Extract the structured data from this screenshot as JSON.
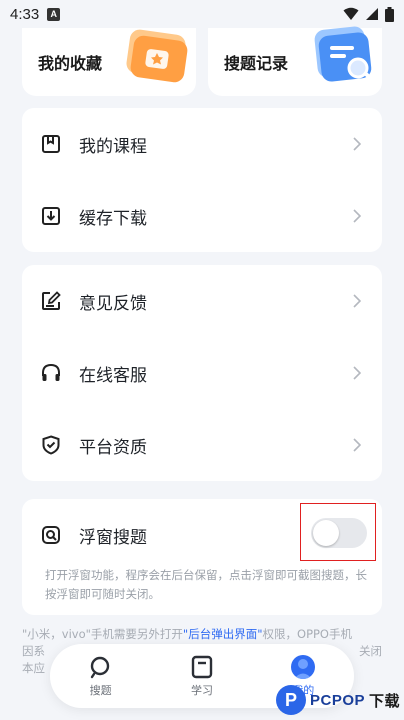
{
  "status": {
    "time": "4:33",
    "app_badge": "A"
  },
  "quick": [
    {
      "label": "我的收藏",
      "icon": "folder-star-icon"
    },
    {
      "label": "搜题记录",
      "icon": "search-doc-icon"
    }
  ],
  "group1": [
    {
      "label": "我的课程",
      "icon": "bookmark-icon"
    },
    {
      "label": "缓存下载",
      "icon": "download-icon"
    }
  ],
  "group2": [
    {
      "label": "意见反馈",
      "icon": "edit-icon"
    },
    {
      "label": "在线客服",
      "icon": "headset-icon"
    },
    {
      "label": "平台资质",
      "icon": "shield-check-icon"
    }
  ],
  "floating": {
    "label": "浮窗搜题",
    "icon": "float-search-icon",
    "toggle_state": "off",
    "desc": "打开浮窗功能，程序会在后台保留，点击浮窗即可截图搜题，长按浮窗即可随时关闭。"
  },
  "notice": {
    "line1_a": "\"小米，vivo\"手机需要另外打开",
    "line1_hl": "\"后台弹出界面\"",
    "line1_b": "权限，OPPO手机",
    "line2": "因系",
    "line2_end": "关闭",
    "line3": "本应"
  },
  "tabs": [
    {
      "label": "搜题",
      "icon": "search-tab-icon",
      "active": false
    },
    {
      "label": "学习",
      "icon": "book-tab-icon",
      "active": false
    },
    {
      "label": "我的",
      "icon": "profile-tab-icon",
      "active": true
    }
  ],
  "watermark": {
    "letter": "P",
    "brand": "PCPOP",
    "suffix": "下载"
  },
  "colors": {
    "accent": "#2f6bf2",
    "highlight_box": "#e02020",
    "background": "#f3f5f9"
  }
}
